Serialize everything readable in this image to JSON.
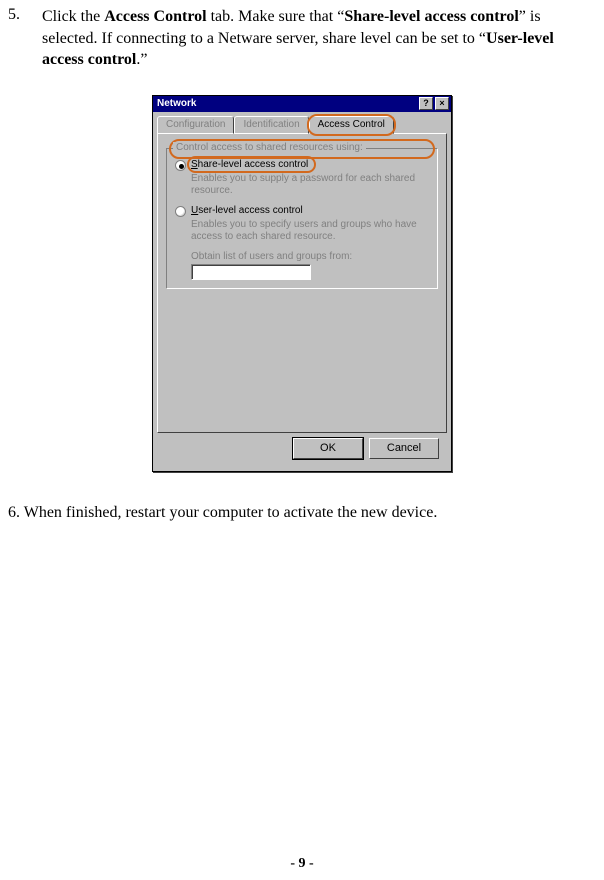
{
  "step5": {
    "num": "5.",
    "t1": "Click the ",
    "b1": "Access Control",
    "t2": " tab.    Make sure that “",
    "b2": "Share-level access control",
    "t3": "” is selected.    If connecting to a Netware server, share level can be set to “",
    "b3": "User-level access control",
    "t4": ".”"
  },
  "dlg": {
    "title": "Network",
    "help_btn": "?",
    "close_btn": "×",
    "tabs": {
      "t1": "Configuration",
      "t2": "Identification",
      "t3": "Access Control"
    },
    "group_legend": "Control access to shared resources using:",
    "opt1": {
      "label_pre": "S",
      "label_rest": "hare-level access control",
      "desc": "Enables you to supply a password for each shared resource."
    },
    "opt2": {
      "label_pre": "U",
      "label_rest": "ser-level access control",
      "desc": "Enables you to specify users and groups who have access to each shared resource."
    },
    "obtain_label_pre": "Obtain ",
    "obtain_label_ul": "l",
    "obtain_label_rest": "ist of users and groups from:",
    "ok": "OK",
    "cancel": "Cancel"
  },
  "step6": "6. When finished, restart your computer to activate the new device.",
  "page_number": "- 9 -"
}
